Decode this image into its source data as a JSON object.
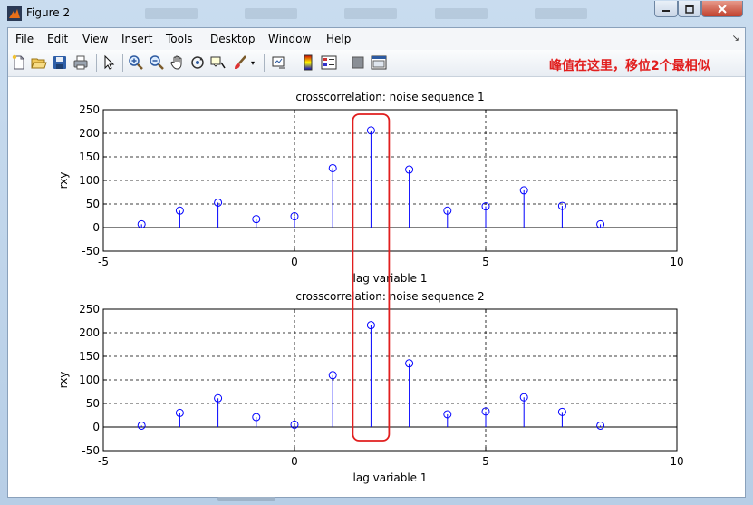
{
  "window": {
    "title": "Figure 2",
    "colors": {
      "title_icon": "#e8701a",
      "close_button": "#c0412d"
    }
  },
  "menu": {
    "items": [
      "File",
      "Edit",
      "View",
      "Insert",
      "Tools",
      "Desktop",
      "Window",
      "Help"
    ],
    "overflow_arrow": "↘"
  },
  "toolbar": {
    "icons": [
      "new-figure-icon",
      "open-file-icon",
      "save-icon",
      "print-icon",
      "pointer-icon",
      "zoom-in-icon",
      "zoom-out-icon",
      "pan-hand-icon",
      "rotate-3d-icon",
      "data-cursor-icon",
      "brush-icon",
      "brush-dropdown-icon",
      "link-plot-icon",
      "colorbar-icon",
      "legend-icon",
      "hide-plot-tools-icon",
      "show-plot-tools-icon"
    ]
  },
  "annotation": {
    "text": "峰值在这里，移位2个最相似",
    "color": "#e11e1e"
  },
  "chart_data": [
    {
      "type": "stem",
      "title": "crosscorrelation: noise sequence 1",
      "xlabel": "lag variable 1",
      "ylabel": "rxy",
      "xlim": [
        -5,
        10
      ],
      "ylim": [
        -50,
        250
      ],
      "xticks": [
        -5,
        0,
        5,
        10
      ],
      "yticks": [
        -50,
        0,
        50,
        100,
        150,
        200,
        250
      ],
      "grid": "dashed",
      "color": "#0000ff",
      "x": [
        -4,
        -3,
        -2,
        -1,
        0,
        1,
        2,
        3,
        4,
        5,
        6,
        7,
        8
      ],
      "y": [
        7,
        36,
        53,
        18,
        24,
        126,
        206,
        123,
        36,
        45,
        79,
        46,
        7
      ]
    },
    {
      "type": "stem",
      "title": "crosscorrelation: noise sequence 2",
      "xlabel": "lag variable 1",
      "ylabel": "rxy",
      "xlim": [
        -5,
        10
      ],
      "ylim": [
        -50,
        250
      ],
      "xticks": [
        -5,
        0,
        5,
        10
      ],
      "yticks": [
        -50,
        0,
        50,
        100,
        150,
        200,
        250
      ],
      "grid": "dashed",
      "color": "#0000ff",
      "x": [
        -4,
        -3,
        -2,
        -1,
        0,
        1,
        2,
        3,
        4,
        5,
        6,
        7,
        8
      ],
      "y": [
        3,
        30,
        61,
        21,
        5,
        110,
        216,
        135,
        27,
        33,
        63,
        32,
        3
      ]
    }
  ],
  "highlight": {
    "x": 2,
    "color": "#e11e1e"
  }
}
